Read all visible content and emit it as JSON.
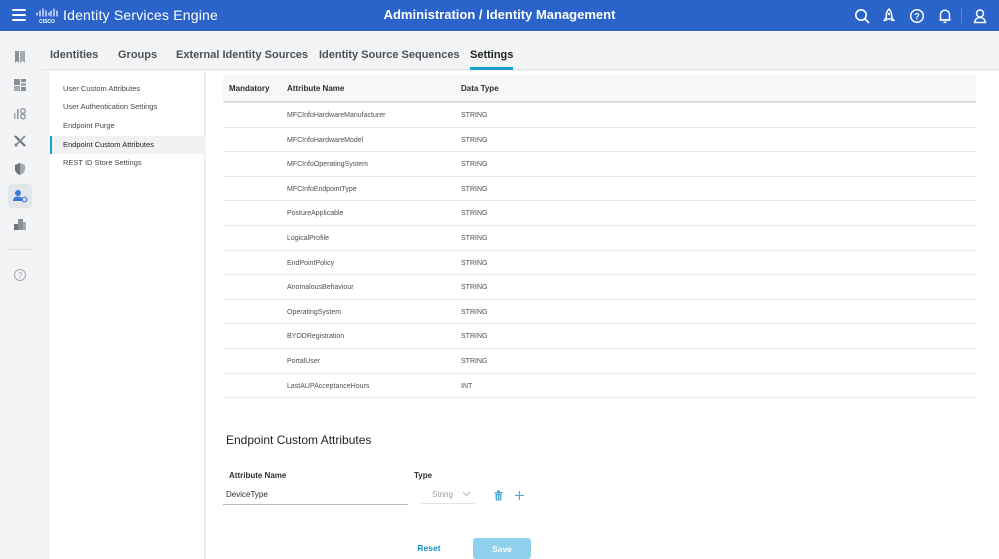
{
  "header": {
    "app_title": "Identity Services Engine",
    "page_title": "Administration / Identity Management",
    "icons": [
      "menu-icon",
      "cisco-logo",
      "search-icon",
      "rocket-icon",
      "help-icon",
      "bell-icon",
      "user-icon"
    ]
  },
  "left_rail": {
    "items": [
      "bookmark-icon",
      "dashboard-icon",
      "context-visibility-icon",
      "operations-icon",
      "policy-icon",
      "administration-icon",
      "work-centers-icon",
      "help-icon"
    ],
    "active": "administration-icon"
  },
  "tabs": [
    {
      "label": "Identities"
    },
    {
      "label": "Groups"
    },
    {
      "label": "External Identity Sources"
    },
    {
      "label": "Identity Source Sequences"
    },
    {
      "label": "Settings",
      "active": true
    }
  ],
  "subnav": {
    "items": [
      {
        "label": "User Custom Attributes"
      },
      {
        "label": "User Authentication Settings"
      },
      {
        "label": "Endpoint Purge"
      },
      {
        "label": "Endpoint Custom Attributes",
        "active": true
      },
      {
        "label": "REST ID Store Settings"
      }
    ]
  },
  "table": {
    "headers": {
      "mandatory": "Mandatory",
      "attribute_name": "Attribute Name",
      "data_type": "Data Type"
    },
    "rows": [
      {
        "name": "MFCInfoHardwareManufacturer",
        "type": "STRING"
      },
      {
        "name": "MFCInfoHardwareModel",
        "type": "STRING"
      },
      {
        "name": "MFCInfoOperatingSystem",
        "type": "STRING"
      },
      {
        "name": "MFCInfoEndpointType",
        "type": "STRING"
      },
      {
        "name": "PostureApplicable",
        "type": "STRING"
      },
      {
        "name": "LogicalProfile",
        "type": "STRING"
      },
      {
        "name": "EndPointPolicy",
        "type": "STRING"
      },
      {
        "name": "AnomalousBehaviour",
        "type": "STRING"
      },
      {
        "name": "OperatingSystem",
        "type": "STRING"
      },
      {
        "name": "BYODRegistration",
        "type": "STRING"
      },
      {
        "name": "PortalUser",
        "type": "STRING"
      },
      {
        "name": "LastAUPAcceptanceHours",
        "type": "INT"
      }
    ]
  },
  "custom_attributes": {
    "title": "Endpoint Custom Attributes",
    "attribute_name_label": "Attribute Name",
    "type_label": "Type",
    "attribute_name_value": "DeviceType",
    "type_value": "String"
  },
  "actions": {
    "reset_label": "Reset",
    "save_label": "Save"
  }
}
